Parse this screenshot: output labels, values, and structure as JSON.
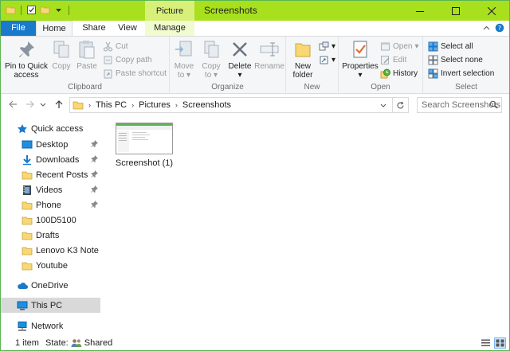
{
  "window": {
    "title": "Screenshots",
    "context_tab": "Picture Tools"
  },
  "tabs": {
    "file": "File",
    "home": "Home",
    "share": "Share",
    "view": "View",
    "manage": "Manage"
  },
  "ribbon": {
    "clipboard": {
      "label": "Clipboard",
      "pin_line1": "Pin to Quick",
      "pin_line2": "access",
      "copy": "Copy",
      "paste": "Paste",
      "cut": "Cut",
      "copy_path": "Copy path",
      "paste_shortcut": "Paste shortcut"
    },
    "organize": {
      "label": "Organize",
      "move_line1": "Move",
      "move_line2": "to",
      "copy_line1": "Copy",
      "copy_line2": "to",
      "delete": "Delete",
      "rename": "Rename"
    },
    "new": {
      "label": "New",
      "folder_line1": "New",
      "folder_line2": "folder"
    },
    "open": {
      "label": "Open",
      "properties": "Properties",
      "open": "Open",
      "edit": "Edit",
      "history": "History"
    },
    "select": {
      "label": "Select",
      "select_all": "Select all",
      "select_none": "Select none",
      "invert": "Invert selection"
    }
  },
  "address": {
    "crumbs": [
      "This PC",
      "Pictures",
      "Screenshots"
    ],
    "search_placeholder": "Search Screenshots"
  },
  "nav": {
    "quick_access": "Quick access",
    "items": [
      {
        "label": "Desktop",
        "pinned": true
      },
      {
        "label": "Downloads",
        "pinned": true
      },
      {
        "label": "Recent Posts",
        "pinned": true
      },
      {
        "label": "Videos",
        "pinned": true
      },
      {
        "label": "Phone",
        "pinned": true
      },
      {
        "label": "100D5100",
        "pinned": false
      },
      {
        "label": "Drafts",
        "pinned": false
      },
      {
        "label": "Lenovo K3 Note",
        "pinned": false
      },
      {
        "label": "Youtube",
        "pinned": false
      }
    ],
    "onedrive": "OneDrive",
    "this_pc": "This PC",
    "network": "Network"
  },
  "files": [
    {
      "name": "Screenshot (1)"
    }
  ],
  "status": {
    "count": "1 item",
    "state_label": "State:",
    "state_value": "Shared"
  },
  "colors": {
    "titlebar": "#a8e01e",
    "file_tab": "#1979ca",
    "context_tab": "#d8f07a",
    "folder": "#f8d775",
    "selection": "#d9d9d9"
  }
}
